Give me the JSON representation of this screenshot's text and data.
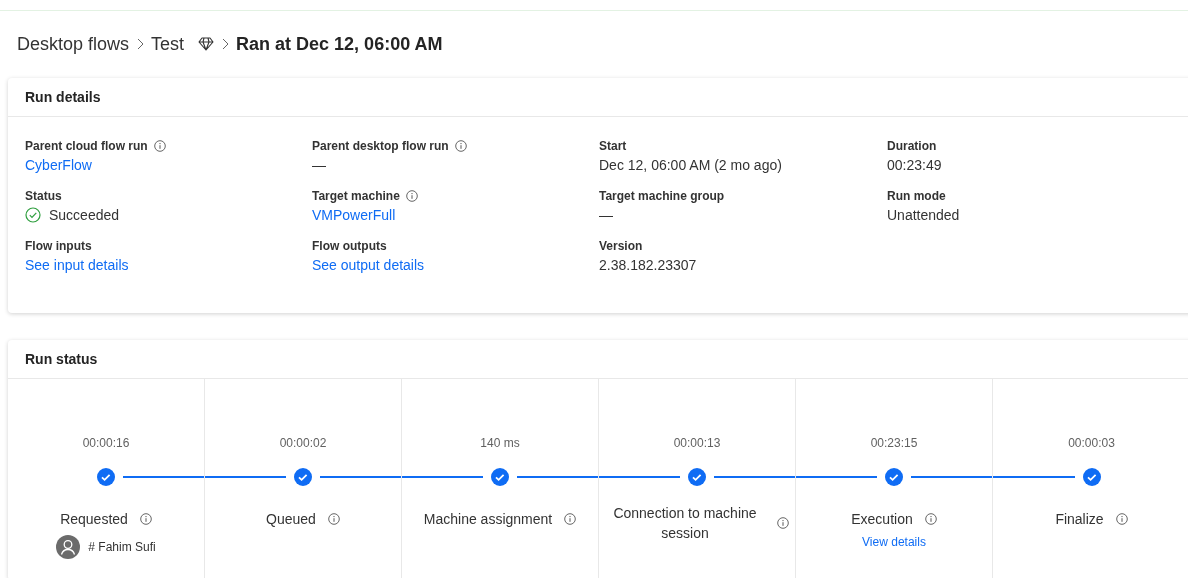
{
  "breadcrumb": {
    "items": [
      {
        "label": "Desktop flows",
        "kind": "link"
      },
      {
        "label": "Test",
        "kind": "premium"
      },
      {
        "label": "Ran at Dec 12, 06:00 AM",
        "kind": "current"
      }
    ]
  },
  "run_details": {
    "title": "Run details",
    "fields": [
      {
        "label": "Parent cloud flow run",
        "info": true,
        "value": "CyberFlow",
        "kind": "link"
      },
      {
        "label": "Parent desktop flow run",
        "info": true,
        "value": "—",
        "kind": "text"
      },
      {
        "label": "Start",
        "info": false,
        "value": "Dec 12, 06:00 AM (2 mo ago)",
        "kind": "text"
      },
      {
        "label": "Duration",
        "info": false,
        "value": "00:23:49",
        "kind": "text"
      },
      {
        "label": "Status",
        "info": false,
        "value": "Succeeded",
        "kind": "status"
      },
      {
        "label": "Target machine",
        "info": true,
        "value": "VMPowerFull",
        "kind": "link"
      },
      {
        "label": "Target machine group",
        "info": false,
        "value": "—",
        "kind": "text"
      },
      {
        "label": "Run mode",
        "info": false,
        "value": "Unattended",
        "kind": "text"
      },
      {
        "label": "Flow inputs",
        "info": false,
        "value": "See input details",
        "kind": "link"
      },
      {
        "label": "Flow outputs",
        "info": false,
        "value": "See output details",
        "kind": "link"
      },
      {
        "label": "Version",
        "info": false,
        "value": "2.38.182.23307",
        "kind": "text"
      }
    ]
  },
  "run_status": {
    "title": "Run status",
    "stages": [
      {
        "time": "00:00:16",
        "label": "Requested",
        "done": true,
        "user": "# Fahim Sufi"
      },
      {
        "time": "00:00:02",
        "label": "Queued",
        "done": true
      },
      {
        "time": "140 ms",
        "label": "Machine assignment",
        "done": true
      },
      {
        "time": "00:00:13",
        "label": "Connection to machine session",
        "done": true
      },
      {
        "time": "00:23:15",
        "label": "Execution",
        "done": true,
        "link": "View details"
      },
      {
        "time": "00:00:03",
        "label": "Finalize",
        "done": true
      }
    ]
  }
}
